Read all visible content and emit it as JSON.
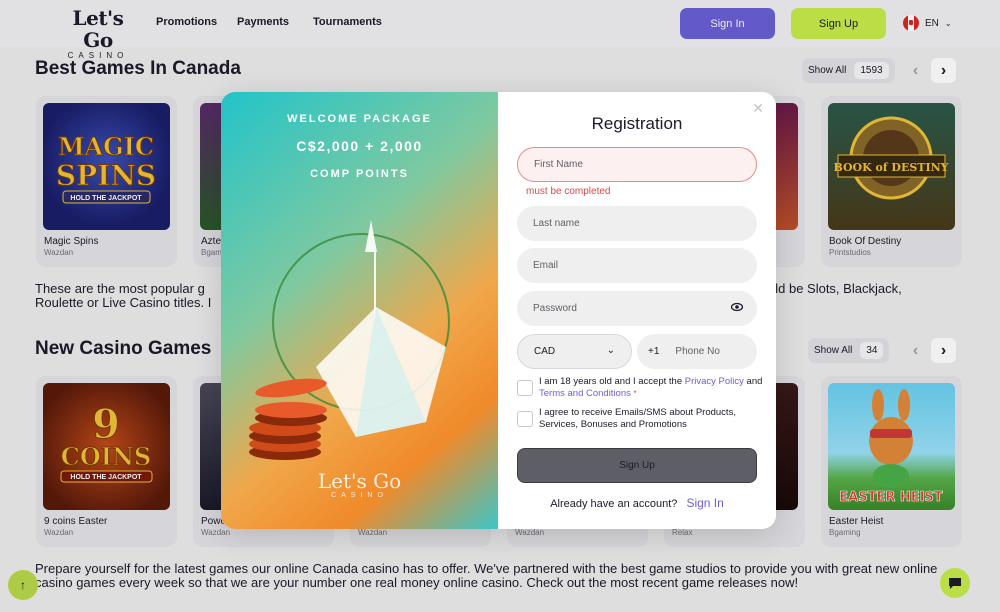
{
  "header": {
    "logo_main": "Let's Go",
    "logo_sub": "CASINO",
    "nav": [
      "Promotions",
      "Payments",
      "Tournaments"
    ],
    "signin_label": "Sign In",
    "signup_label": "Sign Up",
    "lang": "EN"
  },
  "best_games": {
    "title": "Best Games In Canada",
    "show_all": "Show All",
    "count": "1593",
    "games": [
      {
        "name": "Magic Spins",
        "provider": "Wazdan"
      },
      {
        "name": "Azte",
        "provider": "Bgam"
      },
      {
        "name": "Book Of Destiny",
        "provider": "Printstudios"
      }
    ],
    "para_left_1": "These are the most popular g",
    "para_left_2": "Roulette or Live Casino titles. I",
    "para_right": "uld be Slots, Blackjack,"
  },
  "new_games": {
    "title": "New Casino Games",
    "show_all": "Show All",
    "count": "34",
    "games": [
      {
        "name": "9 coins Easter",
        "provider": "Wazdan"
      },
      {
        "name": "Powe",
        "provider": "Wazdan"
      },
      {
        "name": "",
        "provider": "Wazdan"
      },
      {
        "name": "",
        "provider": "Wazdan"
      },
      {
        "name": "",
        "provider": "Relax"
      },
      {
        "name": "Easter Heist",
        "provider": "Bgaming"
      }
    ],
    "para": "Prepare yourself for the latest games our online Canada casino has to offer. We've partnered with the best game studios to provide you with great new online casino games every week so that we are your number one real money online casino. Check out the most recent game releases now!"
  },
  "modal": {
    "promo_line1": "WELCOME PACKAGE",
    "promo_line2": "C$2,000 + 2,000",
    "promo_line3": "COMP POINTS",
    "promo_logo_main": "Let's Go",
    "promo_logo_sub": "CASINO",
    "title": "Registration",
    "first_name_placeholder": "First Name",
    "first_name_error": "must be completed",
    "last_name_placeholder": "Last name",
    "email_placeholder": "Email",
    "password_placeholder": "Password",
    "currency": "CAD",
    "phone_prefix": "+1",
    "phone_placeholder": "Phone No",
    "age_text_pre": "I am 18 years old and I accept the",
    "age_link_privacy": "Privacy Policy",
    "age_text_and": "and",
    "age_link_terms": "Terms and Conditions",
    "required_mark": "*",
    "marketing_text": "I agree to receive Emails/SMS about Products, Services, Bonuses and Promotions",
    "submit_label": "Sign Up",
    "already_text": "Already have an account?",
    "already_link": "Sign In"
  },
  "colors": {
    "primary": "#6b5fd6",
    "accent": "#c7ec4b",
    "error": "#e04545"
  }
}
